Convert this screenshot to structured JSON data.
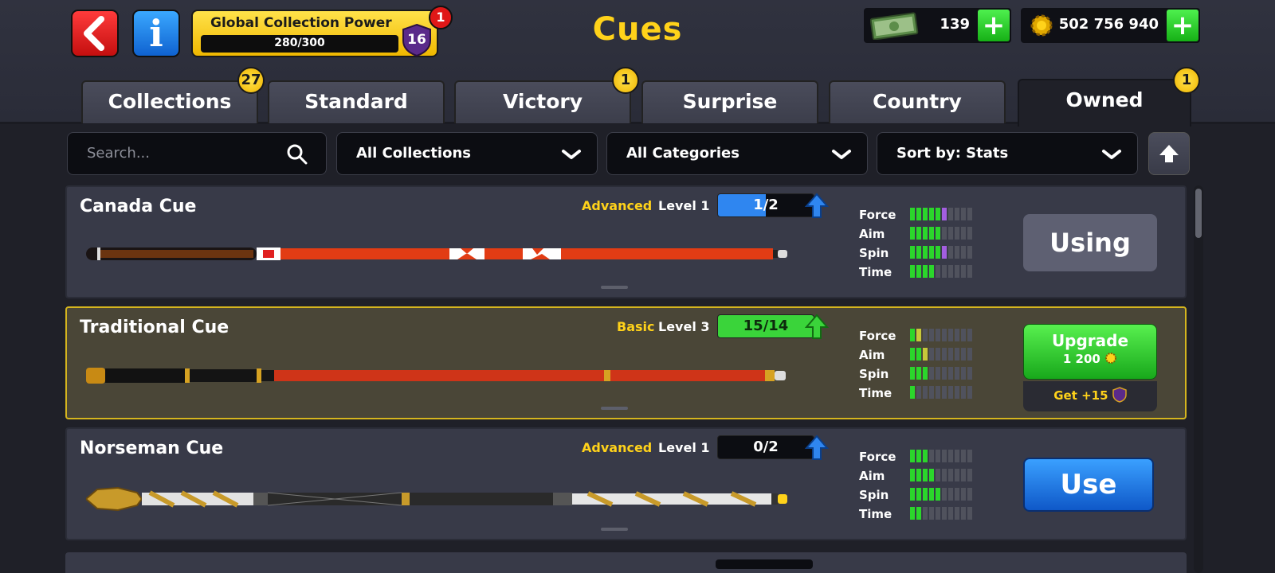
{
  "header": {
    "title": "Cues",
    "collection_power": {
      "label": "Global Collection Power",
      "progress": "280/300",
      "level": "16",
      "notification": "1"
    },
    "cash": "139",
    "coins": "502 756 940"
  },
  "tabs": [
    {
      "label": "Collections",
      "badge": "27"
    },
    {
      "label": "Standard",
      "badge": ""
    },
    {
      "label": "Victory",
      "badge": "1"
    },
    {
      "label": "Surprise",
      "badge": ""
    },
    {
      "label": "Country",
      "badge": ""
    },
    {
      "label": "Owned",
      "badge": "1",
      "active": true
    }
  ],
  "filters": {
    "search_placeholder": "Search...",
    "collections": "All Collections",
    "categories": "All Categories",
    "sort": "Sort by: Stats"
  },
  "stat_labels": [
    "Force",
    "Aim",
    "Spin",
    "Time"
  ],
  "cues": [
    {
      "name": "Canada Cue",
      "category": "Advanced",
      "level": "Level 1",
      "progress": "1/2",
      "progress_fraction": 0.5,
      "progress_color": "#2f86f0",
      "stats": [
        6,
        5,
        6,
        4
      ],
      "stat_colors": [
        "#2bd62b",
        "#2bd62b",
        "#2bd62b",
        "#2bd62b"
      ],
      "stat_extra": [
        1,
        0,
        1,
        0
      ],
      "action": "Using"
    },
    {
      "name": "Traditional Cue",
      "category": "Basic",
      "level": "Level 3",
      "progress": "15/14",
      "progress_fraction": 1.0,
      "progress_color": "#3ad43a",
      "stats": [
        2,
        3,
        3,
        1
      ],
      "stat_colors": [
        "#2bd62b",
        "#2bd62b",
        "#2bd62b",
        "#2bd62b"
      ],
      "stat_extra": [
        1,
        1,
        0,
        0
      ],
      "action": "Upgrade",
      "upgrade_cost": "1 200",
      "bonus": "Get +15"
    },
    {
      "name": "Norseman Cue",
      "category": "Advanced",
      "level": "Level 1",
      "progress": "0/2",
      "progress_fraction": 0.0,
      "progress_color": "#2f86f0",
      "stats": [
        3,
        4,
        5,
        2
      ],
      "stat_colors": [
        "#2bd62b",
        "#2bd62b",
        "#2bd62b",
        "#2bd62b"
      ],
      "stat_extra": [
        0,
        0,
        0,
        0
      ],
      "action": "Use"
    }
  ],
  "colors": {
    "accent": "#ffd21a",
    "plus": "#22c322",
    "using": "#5e6072",
    "use": "#1a6de0"
  }
}
